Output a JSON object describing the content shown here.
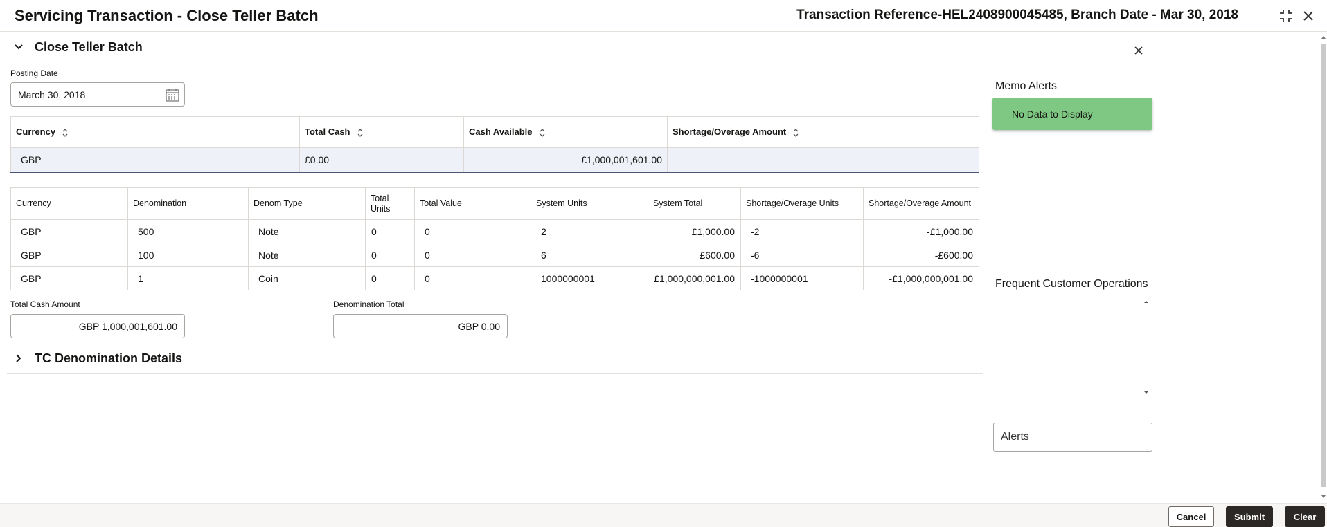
{
  "header": {
    "title": "Servicing Transaction - Close Teller Batch",
    "reference": "Transaction Reference-HEL2408900045485, Branch Date - Mar 30, 2018"
  },
  "section": {
    "title": "Close Teller Batch",
    "posting_date_label": "Posting Date",
    "posting_date_value": "March 30, 2018"
  },
  "summary_table": {
    "columns": [
      "Currency",
      "Total Cash",
      "Cash Available",
      "Shortage/Overage Amount"
    ],
    "row": {
      "currency": "GBP",
      "total_cash": "£0.00",
      "cash_available": "£1,000,001,601.00",
      "shortage_overage": ""
    }
  },
  "denom_table": {
    "columns": [
      "Currency",
      "Denomination",
      "Denom Type",
      "Total Units",
      "Total Value",
      "System Units",
      "System Total",
      "Shortage/Overage Units",
      "Shortage/Overage Amount"
    ],
    "rows": [
      {
        "currency": "GBP",
        "denomination": "500",
        "denom_type": "Note",
        "total_units": "0",
        "total_value": "0",
        "system_units": "2",
        "system_total": "£1,000.00",
        "short_units": "-2",
        "short_amount": "-£1,000.00"
      },
      {
        "currency": "GBP",
        "denomination": "100",
        "denom_type": "Note",
        "total_units": "0",
        "total_value": "0",
        "system_units": "6",
        "system_total": "£600.00",
        "short_units": "-6",
        "short_amount": "-£600.00"
      },
      {
        "currency": "GBP",
        "denomination": "1",
        "denom_type": "Coin",
        "total_units": "0",
        "total_value": "0",
        "system_units": "1000000001",
        "system_total": "£1,000,000,001.00",
        "short_units": "-1000000001",
        "short_amount": "-£1,000,000,001.00"
      }
    ]
  },
  "totals": {
    "total_cash_label": "Total Cash Amount",
    "total_cash_value": "GBP 1,000,001,601.00",
    "denom_total_label": "Denomination Total",
    "denom_total_value": "GBP 0.00"
  },
  "tc_section": {
    "title": "TC Denomination Details"
  },
  "sidebar": {
    "memo_title": "Memo Alerts",
    "memo_empty": "No Data to Display",
    "frequent_title": "Frequent Customer Operations",
    "alerts_label": "Alerts"
  },
  "footer": {
    "cancel": "Cancel",
    "submit": "Submit",
    "clear": "Clear"
  },
  "icons": [
    "minimize-icon",
    "close-icon",
    "chevron-down-icon",
    "chevron-right-icon",
    "calendar-icon",
    "sort-icon",
    "scroll-up-icon",
    "scroll-down-icon"
  ]
}
